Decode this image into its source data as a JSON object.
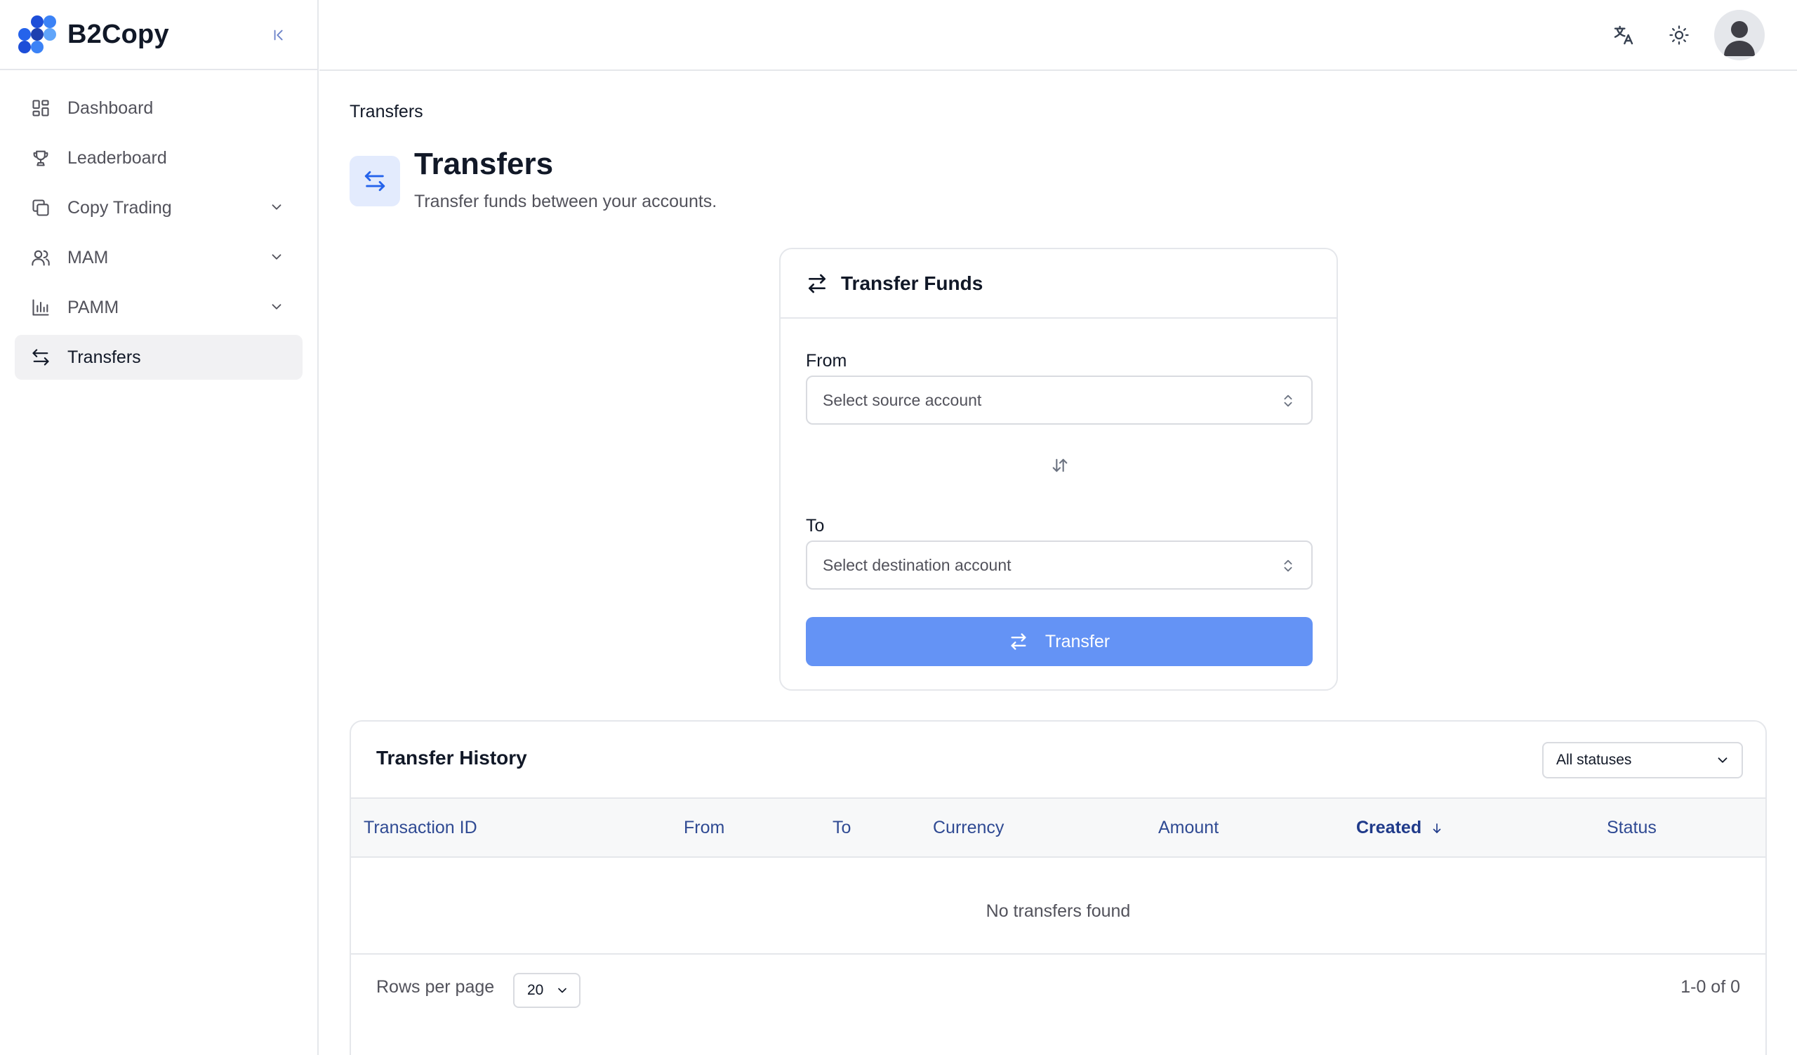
{
  "app": {
    "name": "B2Copy"
  },
  "sidebar": {
    "items": [
      {
        "label": "Dashboard",
        "icon": "dashboard-icon",
        "expandable": false,
        "active": false
      },
      {
        "label": "Leaderboard",
        "icon": "trophy-icon",
        "expandable": false,
        "active": false
      },
      {
        "label": "Copy Trading",
        "icon": "copy-icon",
        "expandable": true,
        "active": false
      },
      {
        "label": "MAM",
        "icon": "users-icon",
        "expandable": true,
        "active": false
      },
      {
        "label": "PAMM",
        "icon": "bar-chart-icon",
        "expandable": true,
        "active": false
      },
      {
        "label": "Transfers",
        "icon": "transfer-icon",
        "expandable": false,
        "active": true
      }
    ]
  },
  "header": {
    "icons": [
      "translate-icon",
      "sun-icon",
      "user-avatar"
    ]
  },
  "page": {
    "breadcrumb": "Transfers",
    "title": "Transfers",
    "subtitle": "Transfer funds between your accounts."
  },
  "transfer_card": {
    "title": "Transfer Funds",
    "from_label": "From",
    "from_placeholder": "Select source account",
    "to_label": "To",
    "to_placeholder": "Select destination account",
    "submit_label": "Transfer"
  },
  "history": {
    "title": "Transfer History",
    "status_filter": "All statuses",
    "columns": [
      "Transaction ID",
      "From",
      "To",
      "Currency",
      "Amount",
      "Created",
      "Status"
    ],
    "sorted_column": "Created",
    "empty_text": "No transfers found",
    "rows_per_page_label": "Rows per page",
    "rows_per_page": "20",
    "range_text": "1-0 of 0"
  },
  "colors": {
    "accent": "#6493f5",
    "accent_light": "#e3ebfd",
    "accent_dark": "#1d4ed8",
    "logo_blue": "#2563eb"
  }
}
